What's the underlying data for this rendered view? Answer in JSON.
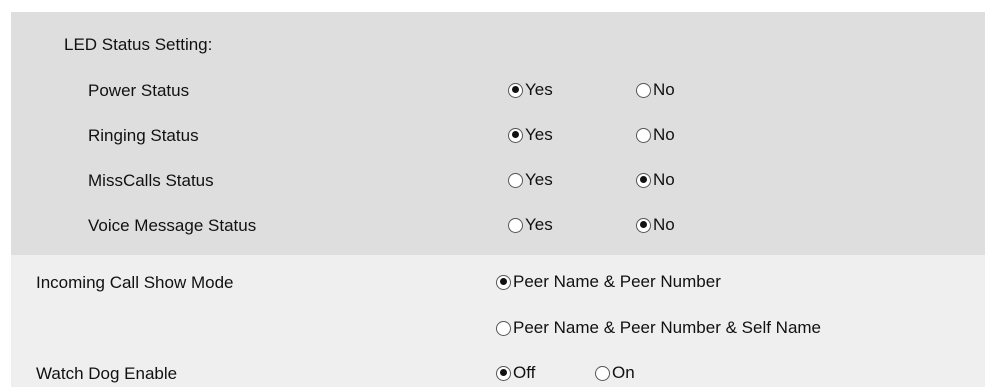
{
  "led_status": {
    "title": "LED Status Setting:",
    "rows": [
      {
        "label": "Power Status",
        "yes_label": "Yes",
        "no_label": "No",
        "selected": "Yes"
      },
      {
        "label": "Ringing Status",
        "yes_label": "Yes",
        "no_label": "No",
        "selected": "Yes"
      },
      {
        "label": "MissCalls Status",
        "yes_label": "Yes",
        "no_label": "No",
        "selected": "No"
      },
      {
        "label": "Voice Message Status",
        "yes_label": "Yes",
        "no_label": "No",
        "selected": "No"
      }
    ]
  },
  "incoming_call_show_mode": {
    "label": "Incoming Call Show Mode",
    "options": [
      "Peer Name & Peer Number",
      "Peer Name & Peer Number & Self Name"
    ],
    "selected": "Peer Name & Peer Number"
  },
  "watch_dog": {
    "label": "Watch Dog Enable",
    "off_label": "Off",
    "on_label": "On",
    "selected": "Off"
  },
  "colors": {
    "led_panel_bg": "#dedede",
    "lower_panel_bg": "#efefef"
  }
}
